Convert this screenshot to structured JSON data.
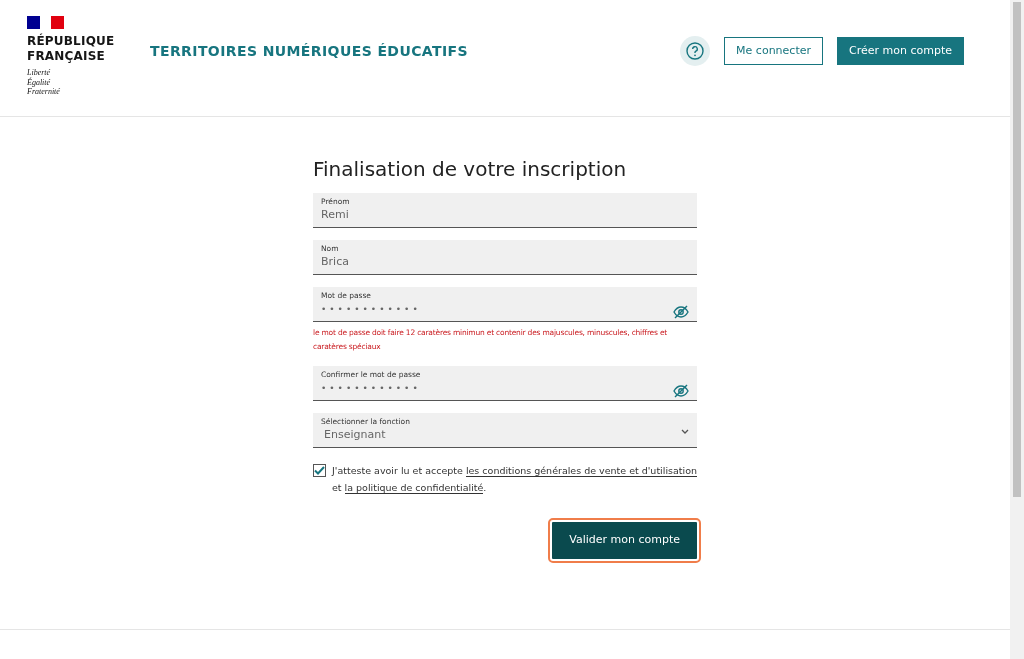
{
  "header": {
    "logo_lines": [
      "RÉPUBLIQUE",
      "FRANÇAISE"
    ],
    "motto": [
      "Liberté",
      "Égalité",
      "Fraternité"
    ],
    "site_title": "TERRITOIRES NUMÉRIQUES ÉDUCATIFS",
    "login": "Me connecter",
    "signup": "Créer mon compte"
  },
  "form": {
    "title": "Finalisation de votre inscription",
    "fields": [
      {
        "kind": "text",
        "label": "Prénom",
        "value": "Remi"
      },
      {
        "kind": "text",
        "label": "Nom",
        "value": "Brica"
      },
      {
        "kind": "password",
        "label": "Mot de passe",
        "value": "••••••••••••",
        "error": "le mot de passe doit faire 12 caratères minimun et contenir des majuscules, minuscules, chiffres et caratères spéciaux"
      },
      {
        "kind": "password",
        "label": "Confirmer le mot de passe",
        "value": "••••••••••••"
      },
      {
        "kind": "select",
        "label": "Sélectionner la fonction",
        "value": "Enseignant"
      }
    ],
    "consent": {
      "checked": true,
      "parts": [
        {
          "kind": "text",
          "text": "J'atteste avoir lu et accepte "
        },
        {
          "kind": "link",
          "text": "les conditions générales de vente et d'utilisation"
        },
        {
          "kind": "text",
          "text": " et "
        },
        {
          "kind": "link",
          "text": "la politique de confidentialité"
        },
        {
          "kind": "text",
          "text": "."
        }
      ]
    },
    "submit": {
      "label": "Valider mon compte",
      "focused": true
    }
  }
}
